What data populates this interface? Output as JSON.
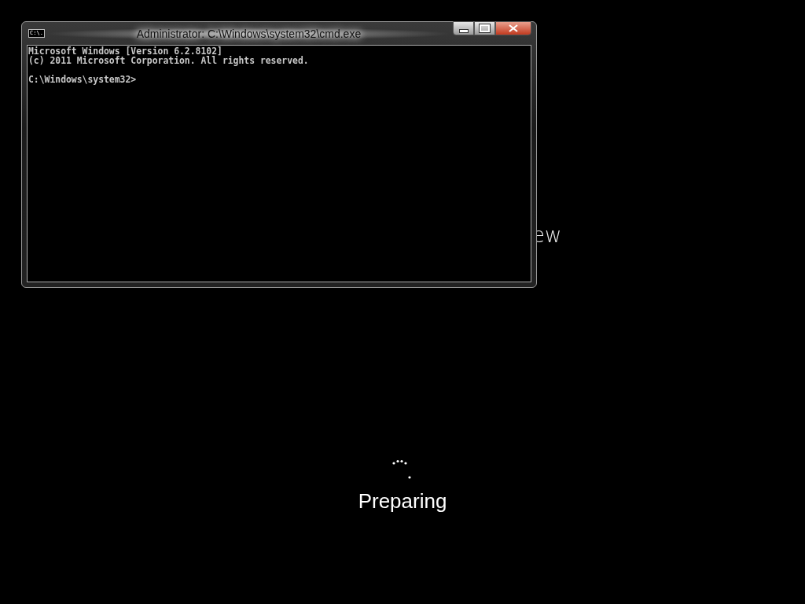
{
  "background_text": "ew",
  "window": {
    "title": "Administrator: C:\\Windows\\system32\\cmd.exe",
    "icon_text": "C:\\.",
    "console_blocks": [
      [
        "Microsoft Windows [Version 6.2.8102]",
        "(c) 2011 Microsoft Corporation. All rights reserved."
      ],
      [
        "C:\\Windows\\system32>"
      ]
    ]
  },
  "status": {
    "text": "Preparing"
  }
}
